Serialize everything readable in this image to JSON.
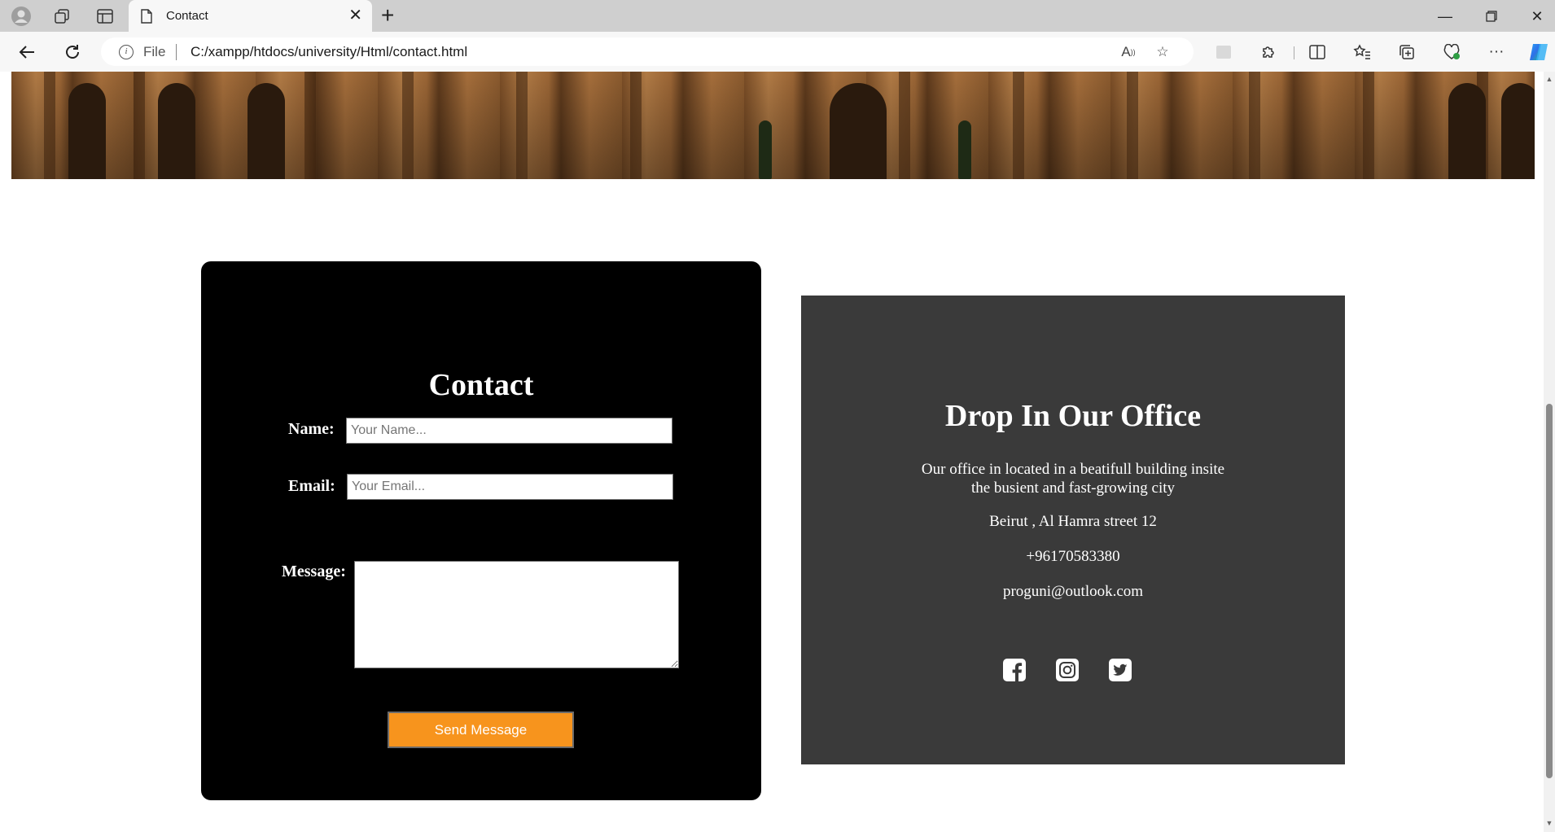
{
  "browser": {
    "tab_title": "Contact",
    "address_scheme": "File",
    "address_url": "C:/xampp/htdocs/university/Html/contact.html"
  },
  "contact_form": {
    "title": "Contact",
    "name_label": "Name:",
    "name_placeholder": "Your Name...",
    "email_label": "Email:",
    "email_placeholder": "Your Email...",
    "message_label": "Message:",
    "submit_label": "Send Message",
    "submit_color": "#f7941d"
  },
  "office": {
    "title": "Drop In Our Office",
    "description": "Our office in located in a beatifull building insite the busient and fast-growing city",
    "address": "Beirut , Al Hamra street 12",
    "phone": "+96170583380",
    "email": "proguni@outlook.com",
    "social_icons": [
      "facebook-icon",
      "instagram-icon",
      "twitter-icon"
    ]
  }
}
